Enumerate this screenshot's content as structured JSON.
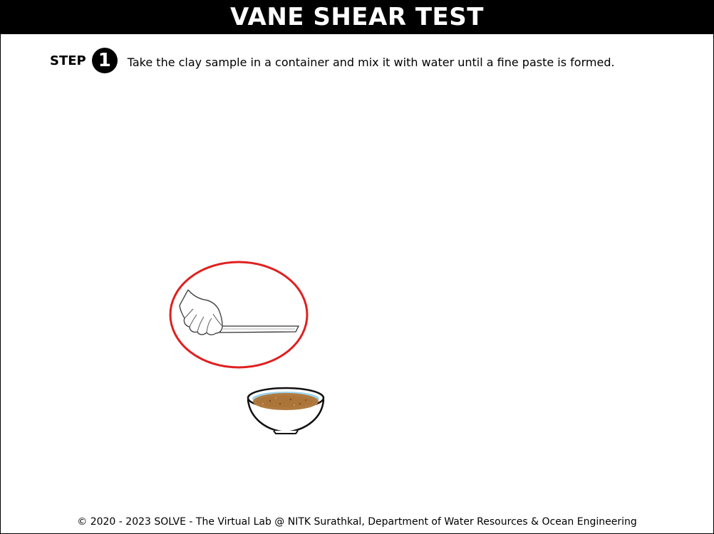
{
  "header": {
    "title": "VANE SHEAR TEST"
  },
  "step": {
    "label": "STEP",
    "number": "1",
    "instruction": "Take the clay sample in a container and mix it with water until a fine paste is formed."
  },
  "scene": {
    "highlight_color": "#e02020",
    "paste_color": "#b07a3f",
    "water_color": "#9fd3ea",
    "icons": [
      "hand-with-spatula-icon",
      "bowl-with-clay-paste-icon"
    ]
  },
  "footer": {
    "copyright": "© 2020 - 2023 SOLVE - The Virtual Lab @ NITK Surathkal, Department of Water Resources & Ocean Engineering"
  }
}
